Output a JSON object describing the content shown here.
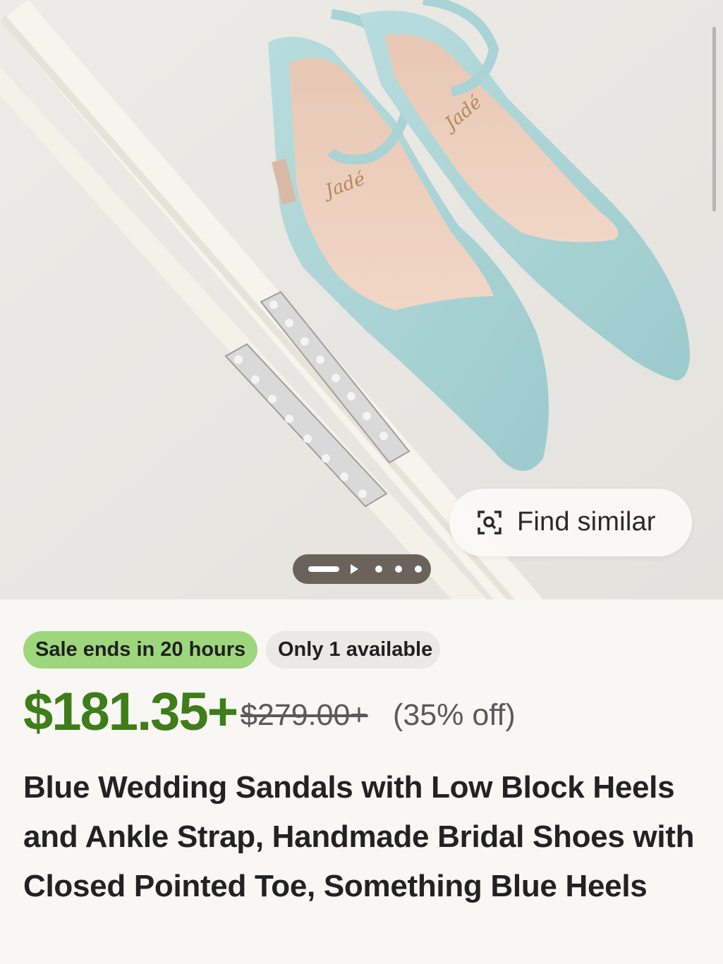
{
  "listing": {
    "image": {
      "description_icon": "product-photo-blue-heels",
      "find_similar_label": "Find similar",
      "find_similar_icon": "visual-search-icon",
      "carousel_total": 5,
      "carousel_active": 1
    },
    "badges": {
      "sale": "Sale ends in 20 hours",
      "stock": "Only 1 available"
    },
    "price": {
      "current": "$181.35+",
      "original": "$279.00+",
      "discount": "(35% off)"
    },
    "title": "Blue Wedding Sandals with Low Block Heels and Ankle Strap, Handmade Bridal Shoes with Closed Pointed Toe, Something Blue Heels",
    "colors": {
      "sale_badge": "#9ed67d",
      "price_green": "#3e7d19",
      "stock_badge": "#ebe9e6",
      "shoe_blue": "#a9d3d5"
    }
  }
}
